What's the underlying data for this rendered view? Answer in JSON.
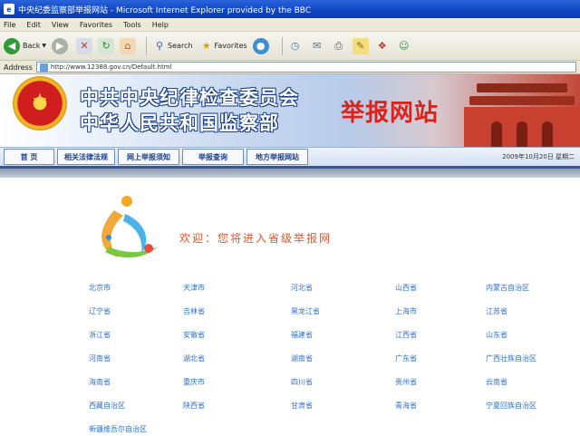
{
  "window": {
    "title": "中央纪委监察部举报网站 - Microsoft Internet Explorer provided by the BBC"
  },
  "menu": [
    "File",
    "Edit",
    "View",
    "Favorites",
    "Tools",
    "Help"
  ],
  "toolbar": {
    "back_label": "Back",
    "search_label": "Search",
    "favorites_label": "Favorites"
  },
  "address": {
    "label": "Address",
    "url": "http://www.12388.gov.cn/Default.html"
  },
  "banner": {
    "line1": "中共中央纪律检查委员会",
    "line2": "中华人民共和国监察部",
    "site_label": "举报网站"
  },
  "nav": {
    "tabs": [
      "首 页",
      "相关法律法规",
      "网上举报须知",
      "举报查询",
      "地方举报网站"
    ],
    "date": "2009年10月20日 星期二"
  },
  "content": {
    "prompt": "欢迎：您将进入省级举报网",
    "regions": [
      "北京市",
      "天津市",
      "河北省",
      "山西省",
      "内蒙古自治区",
      "辽宁省",
      "吉林省",
      "黑龙江省",
      "上海市",
      "江苏省",
      "浙江省",
      "安徽省",
      "福建省",
      "江西省",
      "山东省",
      "河南省",
      "湖北省",
      "湖南省",
      "广东省",
      "广西壮族自治区",
      "海南省",
      "重庆市",
      "四川省",
      "贵州省",
      "云南省",
      "西藏自治区",
      "陕西省",
      "甘肃省",
      "青海省",
      "宁夏回族自治区",
      "新疆维吾尔自治区"
    ]
  },
  "colors": {
    "titlebar": "#0f46c4",
    "site_label": "#d9231b",
    "prompt": "#e2562a",
    "link": "#2d6fd1",
    "nav_border": "#2d57a8"
  }
}
